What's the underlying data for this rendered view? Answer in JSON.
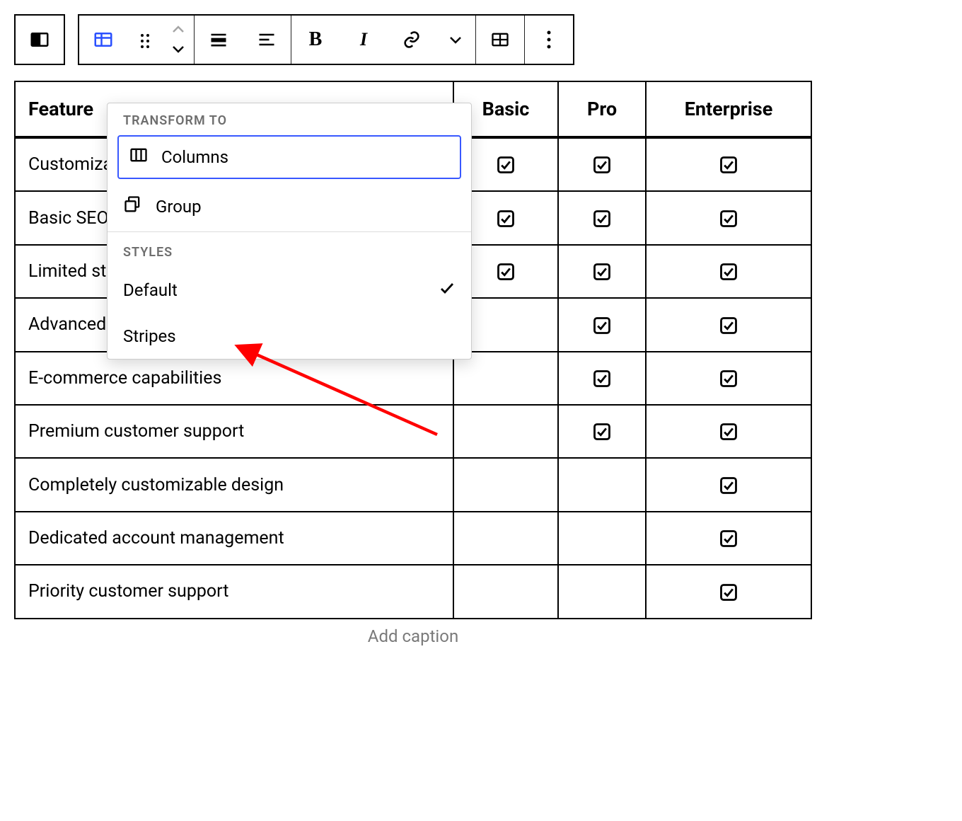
{
  "toolbar": {
    "block_icon": "columns",
    "table_icon": "table",
    "drag_icon": "drag-handle",
    "move_up_icon": "chevron-up",
    "move_down_icon": "chevron-down",
    "align_full_icon": "align-full",
    "align_cell_icon": "align-cell",
    "bold_label": "B",
    "italic_label": "I",
    "link_icon": "link",
    "dropdown_icon": "chevron-down",
    "edit_table_icon": "edit-table",
    "more_icon": "vertical-dots"
  },
  "popover": {
    "transform_label": "TRANSFORM TO",
    "items": [
      {
        "icon": "columns",
        "label": "Columns"
      },
      {
        "icon": "group",
        "label": "Group"
      }
    ],
    "styles_label": "STYLES",
    "styles": [
      {
        "label": "Default",
        "selected": true
      },
      {
        "label": "Stripes",
        "selected": false
      }
    ]
  },
  "table": {
    "headers": [
      "Feature",
      "Basic",
      "Pro",
      "Enterprise"
    ],
    "rows": [
      {
        "feature": "Customizable templates",
        "basic": true,
        "pro": true,
        "ent": true
      },
      {
        "feature": "Basic SEO tools",
        "basic": true,
        "pro": true,
        "ent": true
      },
      {
        "feature": "Limited storage",
        "basic": true,
        "pro": true,
        "ent": true
      },
      {
        "feature": "Advanced SEO tools",
        "basic": false,
        "pro": true,
        "ent": true
      },
      {
        "feature": "E-commerce capabilities",
        "basic": false,
        "pro": true,
        "ent": true
      },
      {
        "feature": "Premium customer support",
        "basic": false,
        "pro": true,
        "ent": true
      },
      {
        "feature": "Completely customizable design",
        "basic": false,
        "pro": false,
        "ent": true
      },
      {
        "feature": "Dedicated account management",
        "basic": false,
        "pro": false,
        "ent": true
      },
      {
        "feature": "Priority customer support",
        "basic": false,
        "pro": false,
        "ent": true
      }
    ],
    "caption_placeholder": "Add caption"
  }
}
